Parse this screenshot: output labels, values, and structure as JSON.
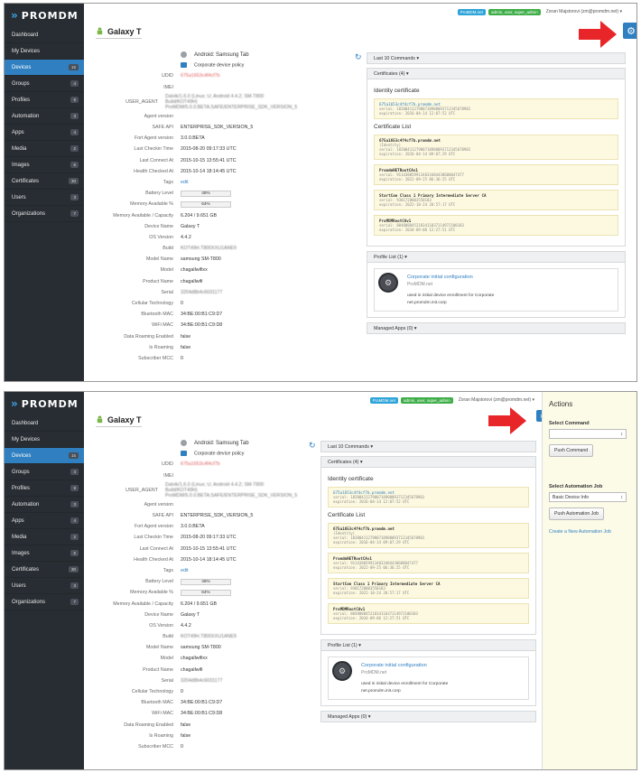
{
  "app": {
    "logo_text": "PROMDM",
    "logo_mark": "»"
  },
  "sidebar": {
    "items": [
      {
        "label": "Dashboard",
        "count": ""
      },
      {
        "label": "My Devices",
        "count": ""
      },
      {
        "label": "Devices",
        "count": "15",
        "active": true
      },
      {
        "label": "Groups",
        "count": "4"
      },
      {
        "label": "Profiles",
        "count": "9"
      },
      {
        "label": "Automation",
        "count": "3"
      },
      {
        "label": "Apps",
        "count": "4"
      },
      {
        "label": "Media",
        "count": "2"
      },
      {
        "label": "Images",
        "count": "6"
      },
      {
        "label": "Certificates",
        "count": "30"
      },
      {
        "label": "Users",
        "count": "3"
      },
      {
        "label": "Organizations",
        "count": "7"
      }
    ]
  },
  "topbar": {
    "badge_org": "ProMDM.net",
    "badge_roles": "admin, user, super_admin",
    "user_name": "Zoran Majstorovi (zm@promdm.net)",
    "user_caret": "▾"
  },
  "page": {
    "title": "Galaxy T"
  },
  "device": {
    "header": "Android: Samsung Tab",
    "policy": "Corporate device policy",
    "rows": [
      {
        "label": "UDID",
        "value": "675a1653c4f4cf7b",
        "style": "red"
      },
      {
        "label": "IMEI",
        "value": "",
        "style": ""
      },
      {
        "label": "USER_AGENT",
        "value": "Dalvik/1.6.0 (Linux; U; Android 4.4.2; SM-T800 Build/KOT49H) ProMDM/5.0.0.BETA;SAFE/ENTERPRISE_SDK_VERSION_5",
        "style": "blur"
      },
      {
        "label": "Agent version",
        "value": "",
        "style": ""
      },
      {
        "label": "SAFE API",
        "value": "ENTERPRISE_SDK_VERSION_5",
        "style": ""
      },
      {
        "label": "Fort Agent version",
        "value": "3.0.0.BETA",
        "style": ""
      },
      {
        "label": "Last Checkin Time",
        "value": "2015-08-20 09:17:33 UTC",
        "style": ""
      },
      {
        "label": "Last Connect At",
        "value": "2015-10-15 13:55:41 UTC",
        "style": ""
      },
      {
        "label": "Health Checked At",
        "value": "2015-10-14 18:14:45 UTC",
        "style": ""
      },
      {
        "label": "Tags",
        "value": "edit",
        "style": "link"
      },
      {
        "label": "Battery Level",
        "value": "46%",
        "style": "bar"
      },
      {
        "label": "Memory Available %",
        "value": "64%",
        "style": "bar"
      },
      {
        "label": "Memory Available / Capacity",
        "value": "6.204 / 9.651 GB",
        "style": ""
      },
      {
        "label": "Device Name",
        "value": "Galaxy T",
        "style": ""
      },
      {
        "label": "OS Version",
        "value": "4.4.2",
        "style": ""
      },
      {
        "label": "Build",
        "value": "KOT49H.T800XXU1ANE9",
        "style": "blur"
      },
      {
        "label": "Model Name",
        "value": "samsung SM-T800",
        "style": ""
      },
      {
        "label": "Model",
        "value": "chagallwifixx",
        "style": ""
      },
      {
        "label": "Product Name",
        "value": "chagallwifi",
        "style": ""
      },
      {
        "label": "Serial",
        "value": "3204d8b4c6031177",
        "style": "blur"
      },
      {
        "label": "Cellular Technology",
        "value": "0",
        "style": ""
      },
      {
        "label": "Bluetooth MAC",
        "value": "34:BE:00:B1:C9:D7",
        "style": ""
      },
      {
        "label": "WiFi MAC",
        "value": "34:BE:00:B1:C9:D8",
        "style": ""
      },
      {
        "label": "Data Roaming Enabled",
        "value": "false",
        "style": ""
      },
      {
        "label": "Is Roaming",
        "value": "false",
        "style": ""
      },
      {
        "label": "Subscriber MCC",
        "value": "0",
        "style": ""
      }
    ]
  },
  "right": {
    "commands_label": "Last 10 Commands ▾",
    "certs_label": "Certificates (4) ▾",
    "identity_title": "Identity certificate",
    "identity_cert": {
      "cn": "675a1653c4f4cf7b.promdm.net",
      "serial": "serial: 1820841127980718908093712345678901",
      "expiration": "expiration: 2016-04-14 12:07:52 UTC"
    },
    "list_title": "Certificate List",
    "cert_list": [
      {
        "cn": "675a1653c4f4cf7b.promdm.net",
        "sub": "(Identity)",
        "serial": "serial: 1820841127980718908093712345678901",
        "expiration": "expiration: 2016-04-14 09:07:29 UTC"
      },
      {
        "cn": "PromdmNETRootCAv1",
        "sub": "",
        "serial": "serial: 9114380599134833404438600047477",
        "expiration": "expiration: 2022-09-25 06:36:25 UTC"
      },
      {
        "cn": "StartCom Class 1 Primary Intermediate Server CA",
        "sub": "",
        "serial": "serial: 9381728003550183",
        "expiration": "expiration: 2022-10-24 20:57:17 UTC"
      },
      {
        "cn": "ProMDMRootCAv1",
        "sub": "",
        "serial": "serial: 8048088452183411037114972100183",
        "expiration": "expiration: 2034-09-06 12:27:51 UTC"
      }
    ],
    "profiles_label": "Profile List (1) ▾",
    "profile": {
      "name": "Corporate initial configuration",
      "org": "ProMDM.net",
      "desc": "used in initial device enrollment for Corporate net.promdm.init.corp"
    },
    "apps_label": "Managed Apps (0) ▾"
  },
  "actions": {
    "title": "Actions",
    "select_command_label": "Select Command",
    "select_command_value": "",
    "push_command": "Push Command",
    "select_job_label": "Select Automation Job",
    "select_job_value": "Basic Device Info",
    "push_job": "Push Automation Job",
    "create_link": "Create a New Automation Job"
  },
  "icons": {
    "gear": "gear-icon",
    "expand": "chevron-right-icon",
    "refresh": "refresh-icon",
    "arrow": "red-arrow-annotation"
  },
  "colors": {
    "sidebar_bg": "#282d33",
    "accent": "#2f7fc1",
    "annotation_red": "#e8262a",
    "actions_bg": "#fcfbe8"
  }
}
